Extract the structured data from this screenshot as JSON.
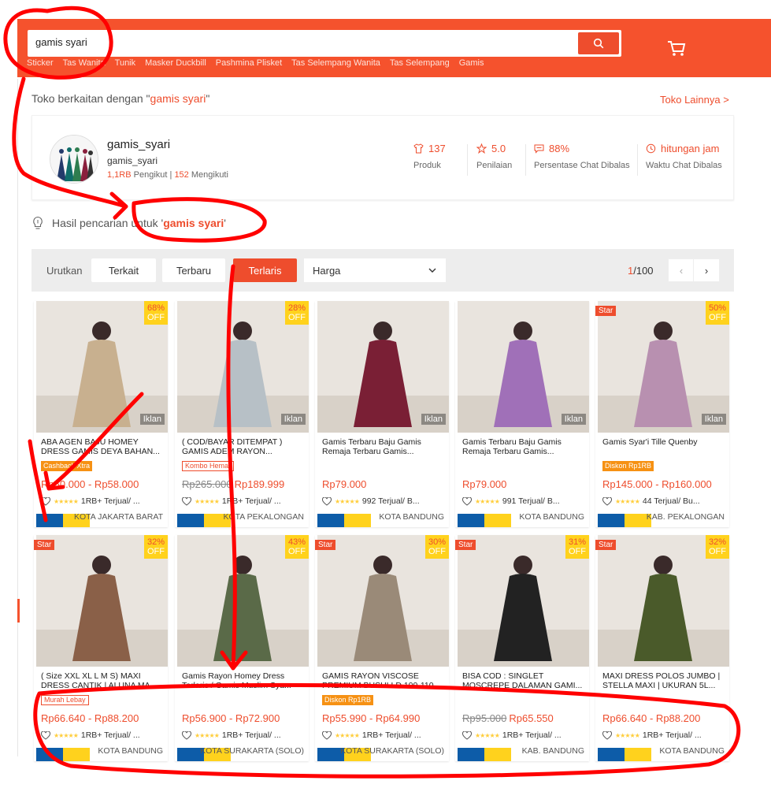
{
  "header": {
    "search_value": "gamis syari",
    "hints": [
      "Sticker",
      "Tas Wanita",
      "Tunik",
      "Masker Duckbill",
      "Pashmina Plisket",
      "Tas Selempang Wanita",
      "Tas Selempang",
      "Gamis"
    ],
    "search_icon": "search-icon",
    "cart_icon": "cart-icon"
  },
  "shops": {
    "heading_prefix": "Toko berkaitan dengan \"",
    "heading_term": "gamis syari",
    "heading_suffix": "\"",
    "more": "Toko Lainnya >",
    "shop": {
      "name": "gamis_syari",
      "username": "gamis_syari",
      "followers": "1,1RB",
      "followers_label": "Pengikut",
      "divider": "|",
      "following": "152",
      "following_label": "Mengikuti"
    },
    "stats": [
      {
        "value": "137",
        "label": "Produk",
        "icon": "shirt-icon"
      },
      {
        "value": "5.0",
        "label": "Penilaian",
        "icon": "star-icon"
      },
      {
        "value": "88%",
        "label": "Persentase Chat Dibalas",
        "icon": "chat-icon"
      },
      {
        "value": "hitungan jam",
        "label": "Waktu Chat Dibalas",
        "icon": "clock-icon"
      }
    ]
  },
  "result": {
    "prefix": "Hasil pencarian untuk '",
    "term": "gamis syari",
    "suffix": "'"
  },
  "sortbar": {
    "label": "Urutkan",
    "buttons": [
      "Terkait",
      "Terbaru",
      "Terlaris"
    ],
    "active": "Terlaris",
    "price_select": "Harga",
    "page_current": "1",
    "page_total": "/100",
    "prev": "‹",
    "next": "›"
  },
  "products": [
    {
      "title": "ABA AGEN BAJU HOMEY DRESS GAMIS DEYA BAHAN...",
      "tag": "Cashback Xtra",
      "tag_style": "fill",
      "price_old": "",
      "price": "Rp50.000 - Rp58.000",
      "sold": "1RB+ Terjual/ ...",
      "location": "KOTA JAKARTA BARAT",
      "discount": "68%",
      "off": "OFF",
      "star": "",
      "ad": "Iklan",
      "color": "#c8b08f"
    },
    {
      "title": "( COD/BAYAR DITEMPAT ) GAMIS ADEM RAYON...",
      "tag": "Kombo Hemat",
      "tag_style": "outline",
      "price_old": "Rp265.000",
      "price": "Rp189.999",
      "sold": "1RB+ Terjual/ ...",
      "location": "KOTA PEKALONGAN",
      "discount": "28%",
      "off": "OFF",
      "star": "",
      "ad": "Iklan",
      "color": "#b7c0c6"
    },
    {
      "title": "Gamis Terbaru Baju Gamis Remaja Terbaru Gamis...",
      "tag": "",
      "tag_style": "",
      "price_old": "",
      "price": "Rp79.000",
      "sold": "992 Terjual/ B...",
      "location": "KOTA BANDUNG",
      "discount": "",
      "off": "",
      "star": "",
      "ad": "Iklan",
      "color": "#7a1f35"
    },
    {
      "title": "Gamis Terbaru Baju Gamis Remaja Terbaru Gamis...",
      "tag": "",
      "tag_style": "",
      "price_old": "",
      "price": "Rp79.000",
      "sold": "991 Terjual/ B...",
      "location": "KOTA BANDUNG",
      "discount": "",
      "off": "",
      "star": "",
      "ad": "Iklan",
      "color": "#a070b8"
    },
    {
      "title": "Gamis Syar'i Tille Quenby",
      "tag": "Diskon Rp1RB",
      "tag_style": "fill",
      "price_old": "",
      "price": "Rp145.000 - Rp160.000",
      "sold": "44 Terjual/ Bu...",
      "location": "KAB. PEKALONGAN",
      "discount": "50%",
      "off": "OFF",
      "star": "Star",
      "ad": "Iklan",
      "color": "#b890b0"
    },
    {
      "title": "( Size XXL XL L M S) MAXI DRESS CANTIK | ALUNA MA...",
      "tag": "Murah Lebay",
      "tag_style": "outline",
      "price_old": "",
      "price": "Rp66.640 - Rp88.200",
      "sold": "1RB+ Terjual/ ...",
      "location": "KOTA BANDUNG",
      "discount": "32%",
      "off": "OFF",
      "star": "Star",
      "ad": "",
      "color": "#8a6048"
    },
    {
      "title": "Gamis Rayon Homey Dress Terlaris / Gamis Muslim Sya...",
      "tag": "",
      "tag_style": "",
      "price_old": "",
      "price": "Rp56.900 - Rp72.900",
      "sold": "1RB+ Terjual/ ...",
      "location": "KOTA SURAKARTA (SOLO)",
      "discount": "43%",
      "off": "OFF",
      "star": "",
      "ad": "",
      "color": "#5a6a48"
    },
    {
      "title": "GAMIS RAYON VISCOSE PREMIUM BUSUI LD 100-110...",
      "tag": "Diskon Rp1RB",
      "tag_style": "fill",
      "price_old": "",
      "price": "Rp55.990 - Rp64.990",
      "sold": "1RB+ Terjual/ ...",
      "location": "KOTA SURAKARTA (SOLO)",
      "discount": "30%",
      "off": "OFF",
      "star": "Star",
      "ad": "",
      "color": "#9a8a78"
    },
    {
      "title": "BISA COD : SINGLET MOSCREPE DALAMAN GAMI...",
      "tag": "",
      "tag_style": "",
      "price_old": "Rp95.000",
      "price": "Rp65.550",
      "sold": "1RB+ Terjual/ ...",
      "location": "KAB. BANDUNG",
      "discount": "31%",
      "off": "OFF",
      "star": "Star",
      "ad": "",
      "color": "#222222"
    },
    {
      "title": "MAXI DRESS POLOS JUMBO | STELLA MAXI | UKURAN 5L...",
      "tag": "",
      "tag_style": "",
      "price_old": "",
      "price": "Rp66.640 - Rp88.200",
      "sold": "1RB+ Terjual/ ...",
      "location": "KOTA BANDUNG",
      "discount": "32%",
      "off": "OFF",
      "star": "Star",
      "ad": "",
      "color": "#4a5a2a"
    }
  ],
  "colors": {
    "brand": "#ee4d2d",
    "header": "#f5522d",
    "annotation": "#ff0000"
  }
}
